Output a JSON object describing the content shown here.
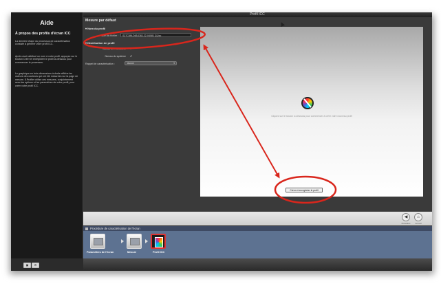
{
  "window": {
    "title": "Profil ICC"
  },
  "help": {
    "title": "Aide",
    "subtitle": "À propos des profils d'écran ICC",
    "paragraphs": [
      "La dernière étape du processus de caractérisation consiste à générer votre profil ICC.",
      "Après avoir attribué un nom à votre profil, appuyez sur le bouton Créer et enregistrer le profil ci-dessous pour commencer le processus.",
      "Le graphique en trois dimensions à droite affiche les valeurs des couleurs qui ont été mesurées sur la page de mesure. i1Profiler utilise ces mesures, conjointement avec les options et les paramètres de votre profil, pour créer votre profil ICC."
    ]
  },
  "main": {
    "title": "Mesure par défaut",
    "profile_section": "Nom du profil",
    "file_name_label": "Nom du fichier :",
    "file_name_value": "S27C6M-D65-D63-22-04081 [1].icc",
    "distribution_section": "Distribution de profil",
    "user_level_label": "Niveau de l'utilisateur",
    "system_level_label": "Niveau du système",
    "check_glyph": "✔",
    "reminder_label": "Rappel de caractérisation :",
    "reminder_value": "Aucun",
    "preview_text": "Cliquez sur le bouton ci-dessous pour commencer à créer votre nouveau profil",
    "create_button": "Créer et enregistrer le profil",
    "nav": {
      "back_label": "Précédent",
      "home_label": "Accueil"
    }
  },
  "workflow": {
    "title": "Procédure de caractérisation de l'écran",
    "steps": [
      {
        "label": "Paramètres de l'écran"
      },
      {
        "label": "Mesure"
      },
      {
        "label": "Profil ICC"
      }
    ]
  },
  "colors": {
    "annotation_red": "#d9261c",
    "workflow_blue": "#5d7291"
  }
}
